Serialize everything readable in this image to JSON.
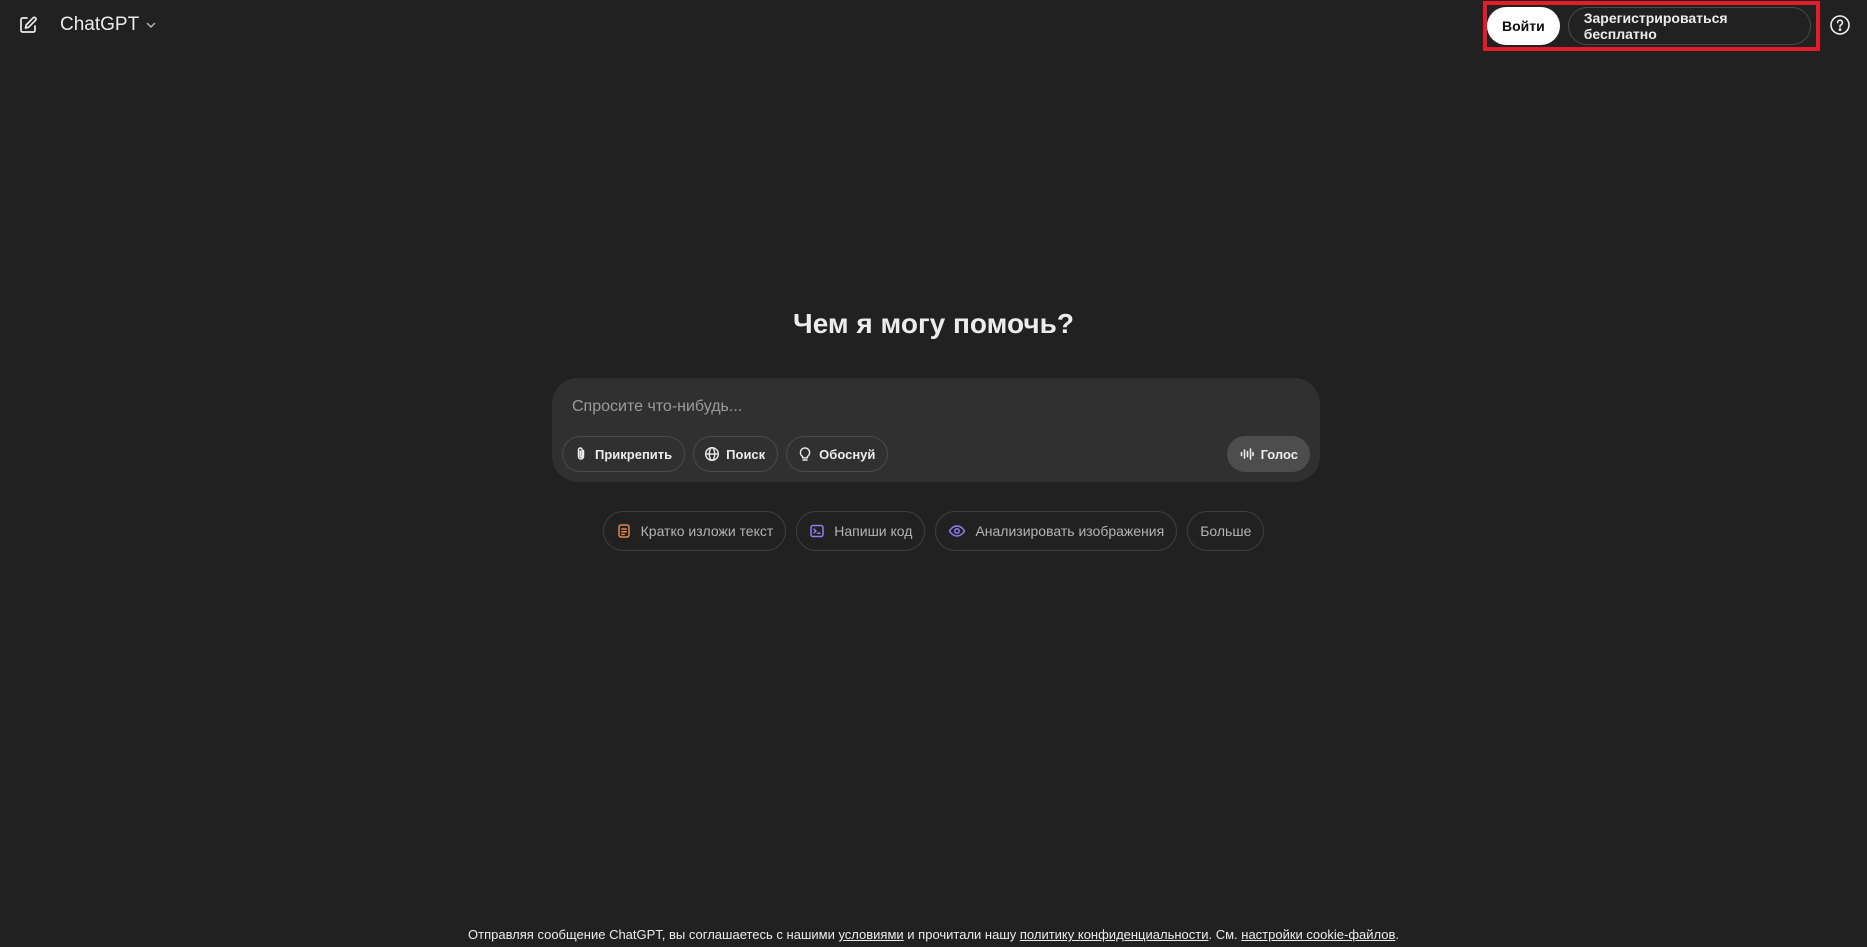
{
  "header": {
    "model_label": "ChatGPT",
    "login_label": "Войти",
    "signup_label": "Зарегистрироваться бесплатно"
  },
  "main": {
    "title": "Чем я могу помочь?",
    "composer": {
      "placeholder": "Спросите что-нибудь...",
      "tools": [
        {
          "label": "Прикрепить",
          "icon": "paperclip-icon"
        },
        {
          "label": "Поиск",
          "icon": "globe-icon"
        },
        {
          "label": "Обоснуй",
          "icon": "lightbulb-icon"
        }
      ],
      "voice_label": "Голос"
    },
    "suggestions": [
      {
        "label": "Кратко изложи текст",
        "icon": "document-icon",
        "color": "#e2874e"
      },
      {
        "label": "Напиши код",
        "icon": "terminal-icon",
        "color": "#8f7ef0"
      },
      {
        "label": "Анализировать изображения",
        "icon": "eye-icon",
        "color": "#8f7ef0"
      },
      {
        "label": "Больше"
      }
    ]
  },
  "footer": {
    "prefix": "Отправляя сообщение ChatGPT, вы соглашаетесь с нашими ",
    "terms_link": "условиями",
    "middle": " и прочитали нашу ",
    "privacy_link": "политику конфиденциальности",
    "middle2": ". См. ",
    "cookie_link": "настройки cookie-файлов",
    "suffix": "."
  },
  "colors": {
    "background": "#212121",
    "composer": "#303030",
    "highlight_border": "#e41b2b"
  }
}
